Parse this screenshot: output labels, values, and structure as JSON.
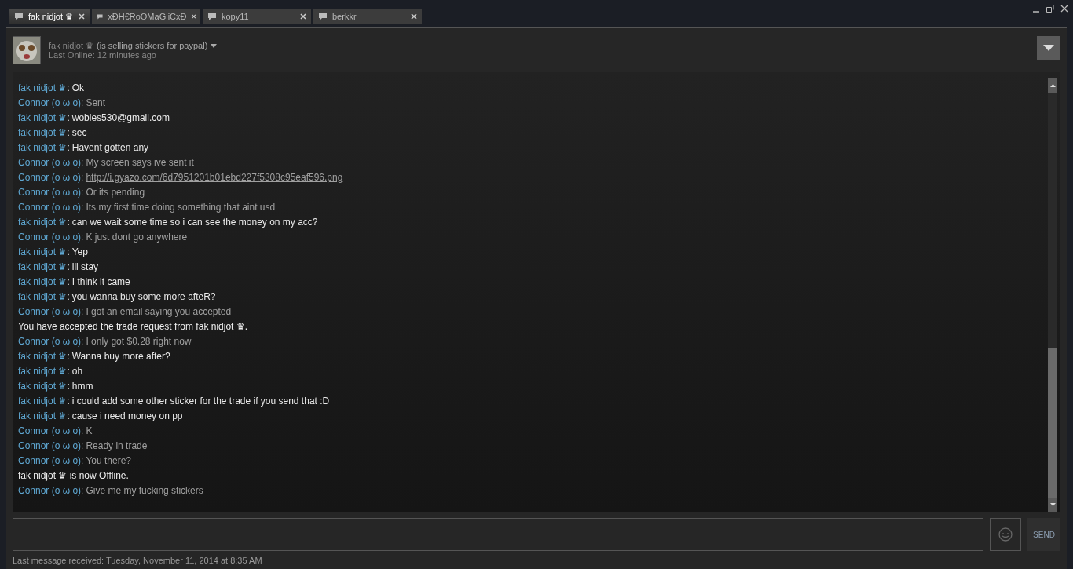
{
  "tabs": [
    {
      "label": "fak nidjot ♛",
      "selected": true
    },
    {
      "label": "xÐH€RoOMaGiiCxÐ",
      "selected": false
    },
    {
      "label": "kopy11",
      "selected": false
    },
    {
      "label": "berkkr",
      "selected": false
    }
  ],
  "header": {
    "name": "fak nidjot ♛",
    "status": "(is selling stickers for paypal)",
    "last_online": "Last Online: 12 minutes ago"
  },
  "messages": [
    {
      "kind": "chat",
      "mine": false,
      "sender": "fak nidjot ♛",
      "separator": ":",
      "text": "Ok"
    },
    {
      "kind": "chat",
      "mine": true,
      "sender": "Connor (o ω o)",
      "separator": ":",
      "text": "Sent"
    },
    {
      "kind": "chat",
      "mine": false,
      "sender": "fak nidjot ♛",
      "separator": ":",
      "text": "wobles530@gmail.com",
      "link": true
    },
    {
      "kind": "chat",
      "mine": false,
      "sender": "fak nidjot ♛",
      "separator": ":",
      "text": "sec"
    },
    {
      "kind": "chat",
      "mine": false,
      "sender": "fak nidjot ♛",
      "separator": ":",
      "text": "Havent gotten any"
    },
    {
      "kind": "chat",
      "mine": true,
      "sender": "Connor (o ω o)",
      "separator": ":",
      "text": "My screen says ive sent it"
    },
    {
      "kind": "chat",
      "mine": true,
      "sender": "Connor (o ω o)",
      "separator": ":",
      "text": "http://i.gyazo.com/6d7951201b01ebd227f5308c95eaf596.png",
      "link": true
    },
    {
      "kind": "chat",
      "mine": true,
      "sender": "Connor (o ω o)",
      "separator": ":",
      "text": "Or its pending"
    },
    {
      "kind": "chat",
      "mine": true,
      "sender": "Connor (o ω o)",
      "separator": ":",
      "text": "Its my first time doing something that aint usd"
    },
    {
      "kind": "chat",
      "mine": false,
      "sender": "fak nidjot ♛",
      "separator": ":",
      "text": "can we wait some time so i can see the money on my acc?"
    },
    {
      "kind": "chat",
      "mine": true,
      "sender": "Connor (o ω o)",
      "separator": ":",
      "text": "K just dont go anywhere"
    },
    {
      "kind": "chat",
      "mine": false,
      "sender": "fak nidjot ♛",
      "separator": ":",
      "text": "Yep"
    },
    {
      "kind": "chat",
      "mine": false,
      "sender": "fak nidjot ♛",
      "separator": ":",
      "text": "ill stay"
    },
    {
      "kind": "chat",
      "mine": false,
      "sender": "fak nidjot ♛",
      "separator": ":",
      "text": "I think it came"
    },
    {
      "kind": "chat",
      "mine": false,
      "sender": "fak nidjot ♛",
      "separator": ":",
      "text": "you wanna buy some more afteR?"
    },
    {
      "kind": "chat",
      "mine": true,
      "sender": "Connor (o ω o)",
      "separator": ":",
      "text": "I got an email saying you accepted"
    },
    {
      "kind": "event",
      "text": "You have accepted the trade request from fak nidjot ♛."
    },
    {
      "kind": "chat",
      "mine": true,
      "sender": "Connor (o ω o)",
      "separator": ":",
      "text": "I only got $0.28 right now"
    },
    {
      "kind": "chat",
      "mine": false,
      "sender": "fak nidjot ♛",
      "separator": ":",
      "text": "Wanna buy more after?"
    },
    {
      "kind": "chat",
      "mine": false,
      "sender": "fak nidjot ♛",
      "separator": ":",
      "text": "oh"
    },
    {
      "kind": "chat",
      "mine": false,
      "sender": "fak nidjot ♛",
      "separator": ":",
      "text": "hmm"
    },
    {
      "kind": "chat",
      "mine": false,
      "sender": "fak nidjot ♛",
      "separator": ":",
      "text": "i could add some other sticker for the trade if you send that :D"
    },
    {
      "kind": "chat",
      "mine": false,
      "sender": "fak nidjot ♛",
      "separator": ":",
      "text": "cause i need money on pp"
    },
    {
      "kind": "chat",
      "mine": true,
      "sender": "Connor (o ω o)",
      "separator": ":",
      "text": "K"
    },
    {
      "kind": "chat",
      "mine": true,
      "sender": "Connor (o ω o)",
      "separator": ":",
      "text": "Ready in trade"
    },
    {
      "kind": "chat",
      "mine": true,
      "sender": "Connor (o ω o)",
      "separator": ":",
      "text": "You there?"
    },
    {
      "kind": "event",
      "text": "fak nidjot ♛ is now Offline."
    },
    {
      "kind": "chat",
      "mine": true,
      "sender": "Connor (o ω o)",
      "separator": ":",
      "text": "Give me my fucking stickers"
    }
  ],
  "send_button": "SEND",
  "footer": "Last message received: Tuesday, November 11, 2014 at 8:35 AM"
}
